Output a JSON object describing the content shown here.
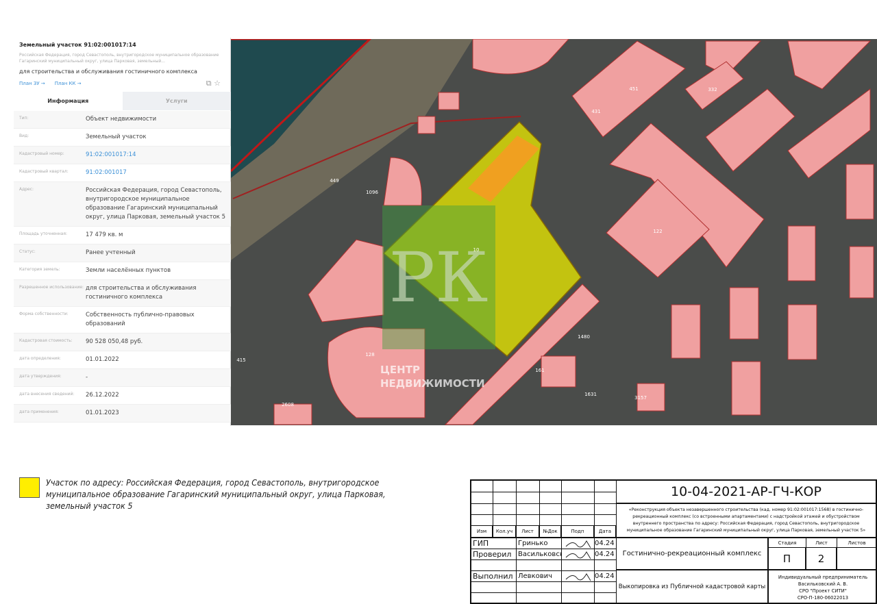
{
  "panel": {
    "title": "Земельный участок 91:02:001017:14",
    "address_short": "Российская Федерация, город Севастополь, внутригородское муниципальное образование Гагаринский муниципальный округ, улица Парковая, земельный...",
    "use": "для строительства и обслуживания гостиничного комплекса",
    "link_plan_zu": "План ЗУ →",
    "link_plan_kk": "План КК →",
    "tabs": [
      "Информация",
      "Услуги"
    ],
    "rows": [
      {
        "label": "Тип:",
        "value": "Объект недвижимости"
      },
      {
        "label": "Вид:",
        "value": "Земельный участок"
      },
      {
        "label": "Кадастровый номер:",
        "value": "91:02:001017:14"
      },
      {
        "label": "Кадастровый квартал:",
        "value": "91:02:001017"
      },
      {
        "label": "Адрес:",
        "value": "Российская Федерация, город Севастополь, внутригородское муниципальное образование Гагаринский муниципальный округ, улица Парковая, земельный участок 5"
      },
      {
        "label": "Площадь уточненная:",
        "value": "17 479 кв. м"
      },
      {
        "label": "Статус:",
        "value": "Ранее учтенный"
      },
      {
        "label": "Категория земель:",
        "value": "Земли населённых пунктов"
      },
      {
        "label": "Разрешенное использование:",
        "value": "для строительства и обслуживания гостиничного комплекса"
      },
      {
        "label": "Форма собственности:",
        "value": "Собственность публично-правовых образований"
      },
      {
        "label": "Кадастровая стоимость:",
        "value": "90 528 050,48 руб."
      },
      {
        "label": "дата определения:",
        "value": "01.01.2022"
      },
      {
        "label": "дата утверждения:",
        "value": "-"
      },
      {
        "label": "дата внесения сведений:",
        "value": "26.12.2022"
      },
      {
        "label": "дата применения:",
        "value": "01.01.2023"
      }
    ]
  },
  "map": {
    "labels": [
      "431",
      "451",
      "332",
      "122",
      "1096",
      "449",
      "128",
      "1631",
      "1480",
      "161",
      "3157",
      "415",
      "2608",
      "10"
    ],
    "watermark_logo": "РК",
    "watermark_text_1": "ЦЕНТР",
    "watermark_text_2": "НЕДВИЖИМОСТИ",
    "parcel_color": "#ffee00"
  },
  "legend": {
    "text": "Участок по адресу: Российская Федерация, город Севастополь, внутригородское муниципальное образование Гагаринский муниципальный округ, улица Парковая, земельный участок 5"
  },
  "stamp": {
    "code": "10-04-2021-АР-ГЧ-КОР",
    "project": "«Реконструкция объекта незавершенного строительства (кад. номер 91:02:001017:1568) в гостинично-рекреационный комплекс (со встроенными апартаментами) с надстройкой этажей и обустройством внутреннего пространства по адресу: Российская Федерация, город Севастополь, внутригородское муниципальное образование Гагаринский муниципальный округ, улица Парковая, земельный участок 5»",
    "headers": [
      "Изм",
      "Кол.уч",
      "Лист",
      "№Док",
      "Подп",
      "Дата"
    ],
    "people": [
      {
        "role": "ГИП",
        "name": "Гринько",
        "date": "04.24"
      },
      {
        "role": "Проверил",
        "name": "Васильковский",
        "date": "04.24"
      },
      {
        "role": "Выполнил",
        "name": "Левкович",
        "date": "04.24"
      }
    ],
    "object": "Гостинично-рекреационный комплекс",
    "stage_h": "Стадия",
    "sheet_h": "Лист",
    "sheets_h": "Листов",
    "stage": "П",
    "sheet": "2",
    "sheets": "",
    "drawing": "Выкопировка из Публичной кадастровой карты",
    "org": [
      "Индивидуальный предприниматель",
      "Васильковский А. В.",
      "СРО \"Проект СИТИ\"",
      "СРО-П-180-06022013"
    ]
  }
}
